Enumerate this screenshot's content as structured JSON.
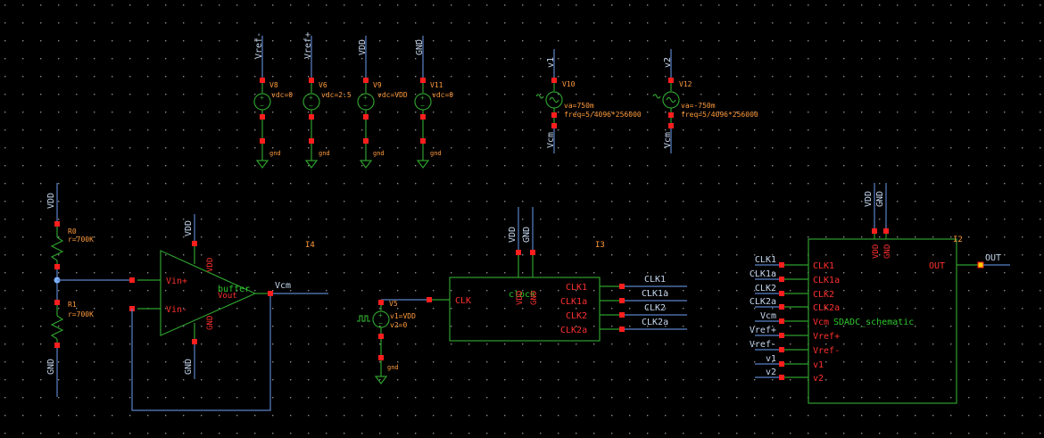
{
  "theme": {
    "background": "#000000",
    "wire": "#5a82c8",
    "component": "#2e9e2e",
    "pin": "#ff1e1e",
    "label_blue": "#c6d8f0",
    "label_orange": "#ff9a3c",
    "selected_node": "#7fb2ff",
    "output_pin": "#ffcc00",
    "grid_dot": "#8a8a8a"
  },
  "supply_sources": [
    {
      "net": "Vref-",
      "inst": "V8",
      "param": "vdc=0",
      "gnd": "gnd"
    },
    {
      "net": "Vref+",
      "inst": "V6",
      "param": "vdc=2.5",
      "gnd": "gnd"
    },
    {
      "net": "VDD",
      "inst": "V9",
      "param": "vdc=VDD",
      "gnd": "gnd"
    },
    {
      "net": "GND",
      "inst": "V11",
      "param": "vdc=0",
      "gnd": "gnd"
    }
  ],
  "sine_sources": [
    {
      "net": "v1",
      "inst": "V10",
      "param1": "va=750m",
      "param2": "freq=5/4096*256000",
      "ref": "Vcm"
    },
    {
      "net": "v2",
      "inst": "V12",
      "param1": "va=-750m",
      "param2": "freq=5/4096*256000",
      "ref": "Vcm"
    }
  ],
  "divider": {
    "top_net": "VDD",
    "bottom_net": "GND",
    "r0_name": "R0",
    "r0_val": "r=700K",
    "r1_name": "R1",
    "r1_val": "r=700K"
  },
  "buffer": {
    "inst": "I4",
    "name": "buffer",
    "pin_pos": "Vin+",
    "pin_neg": "Vin-",
    "pin_vdd": "VDD",
    "pin_gnd": "GND",
    "pin_out": "Vout",
    "net_top": "VDD",
    "net_bottom": "GND",
    "out_net": "Vcm"
  },
  "pulse_source": {
    "inst": "V5",
    "param1": "v1=VDD",
    "param2": "v2=0",
    "gnd": "gnd"
  },
  "clock": {
    "inst": "I3",
    "name": "clock",
    "in_pin": "CLK",
    "pin_vdd": "VDD",
    "pin_gnd": "GND",
    "net_vdd": "VDD",
    "net_gnd": "GND",
    "outputs": [
      "CLK1",
      "CLK1a",
      "CLK2",
      "CLK2a"
    ],
    "wire_labels": [
      "CLK1",
      "CLK1a",
      "CLK2",
      "CLK2a"
    ]
  },
  "sdadc": {
    "inst": "I2",
    "name": "SDADC_schematic",
    "pin_vdd": "VDD",
    "pin_gnd": "GND",
    "net_vdd": "VDD",
    "net_gnd": "GND",
    "pin_out": "OUT",
    "out_net": "OUT",
    "pins": [
      "CLK1",
      "CLK1a",
      "CLK2",
      "CLK2a",
      "Vcm",
      "Vref+",
      "Vref-",
      "v1",
      "v2"
    ],
    "nets": [
      "CLK1",
      "CLK1a",
      "CLK2",
      "CLK2a",
      "Vcm",
      "Vref+",
      "Vref-",
      "v1",
      "v2"
    ]
  }
}
